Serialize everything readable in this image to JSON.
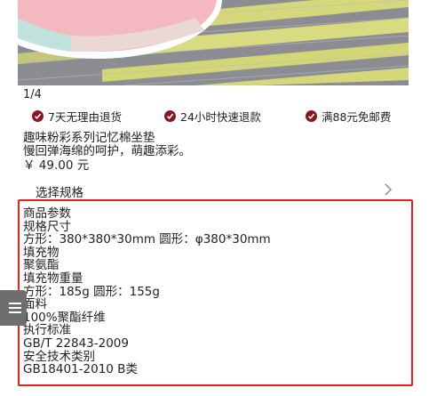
{
  "gallery": {
    "counter": "1/4"
  },
  "services": [
    {
      "label": "7天无理由退货"
    },
    {
      "label": "24小时快速退款"
    },
    {
      "label": "满88元免邮费"
    }
  ],
  "product": {
    "title": "趣味粉彩系列记忆棉坐垫",
    "subtitle": "慢回弹海绵的呵护，萌趣添彩。",
    "price": "￥ 49.00 元"
  },
  "spec_selector": {
    "label": "选择规格"
  },
  "params": {
    "heading": "商品参数",
    "items": [
      {
        "name": "规格尺寸",
        "value": "方形：380*380*30mm 圆形：φ380*30mm"
      },
      {
        "name": "填充物",
        "value": "聚氨酯"
      },
      {
        "name": "填充物重量",
        "value": "方形：185g 圆形：155g"
      },
      {
        "name": "面料",
        "value": "100%聚酯纤维"
      },
      {
        "name": "执行标准",
        "value": "GB/T 22843-2009"
      },
      {
        "name": "安全技术类别",
        "value": "GB18401-2010 B类"
      }
    ]
  },
  "colors": {
    "accent_red": "#e42020",
    "badge": "#8b1420"
  },
  "icons": {
    "service": "check-circle-icon",
    "spec": "chevron-right-icon",
    "handle": "menu-icon"
  }
}
